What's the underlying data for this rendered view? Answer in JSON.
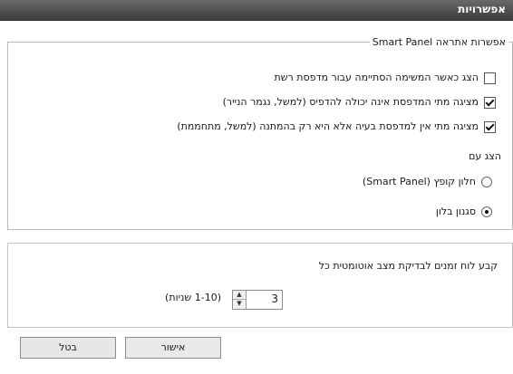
{
  "window": {
    "title": "אפשרויות"
  },
  "alert_group": {
    "legend": "אפשרות אתראה Smart Panel",
    "options": [
      {
        "label": "הצג כאשר המשימה הסתיימה עבור מדפסת רשת",
        "checked": false
      },
      {
        "label": "מציגה מתי המדפסת אינה יכולה להדפיס (למשל, נגמר הנייר)",
        "checked": true
      },
      {
        "label": "מציגה מתי אין למדפסת בעיה אלא היא רק בהמתנה (למשל, מתחממת)",
        "checked": true
      }
    ],
    "display_with_label": "הצג עם",
    "radios": [
      {
        "label": "חלון קופץ (Smart Panel)",
        "checked": false
      },
      {
        "label": "סגנון בלון",
        "checked": true
      }
    ]
  },
  "schedule": {
    "label": "קבע לוח זמנים לבדיקת מצב אוטומטית כל",
    "value": "3",
    "unit": "(1-10 שניות)"
  },
  "buttons": {
    "ok": "אישור",
    "cancel": "בטל"
  }
}
